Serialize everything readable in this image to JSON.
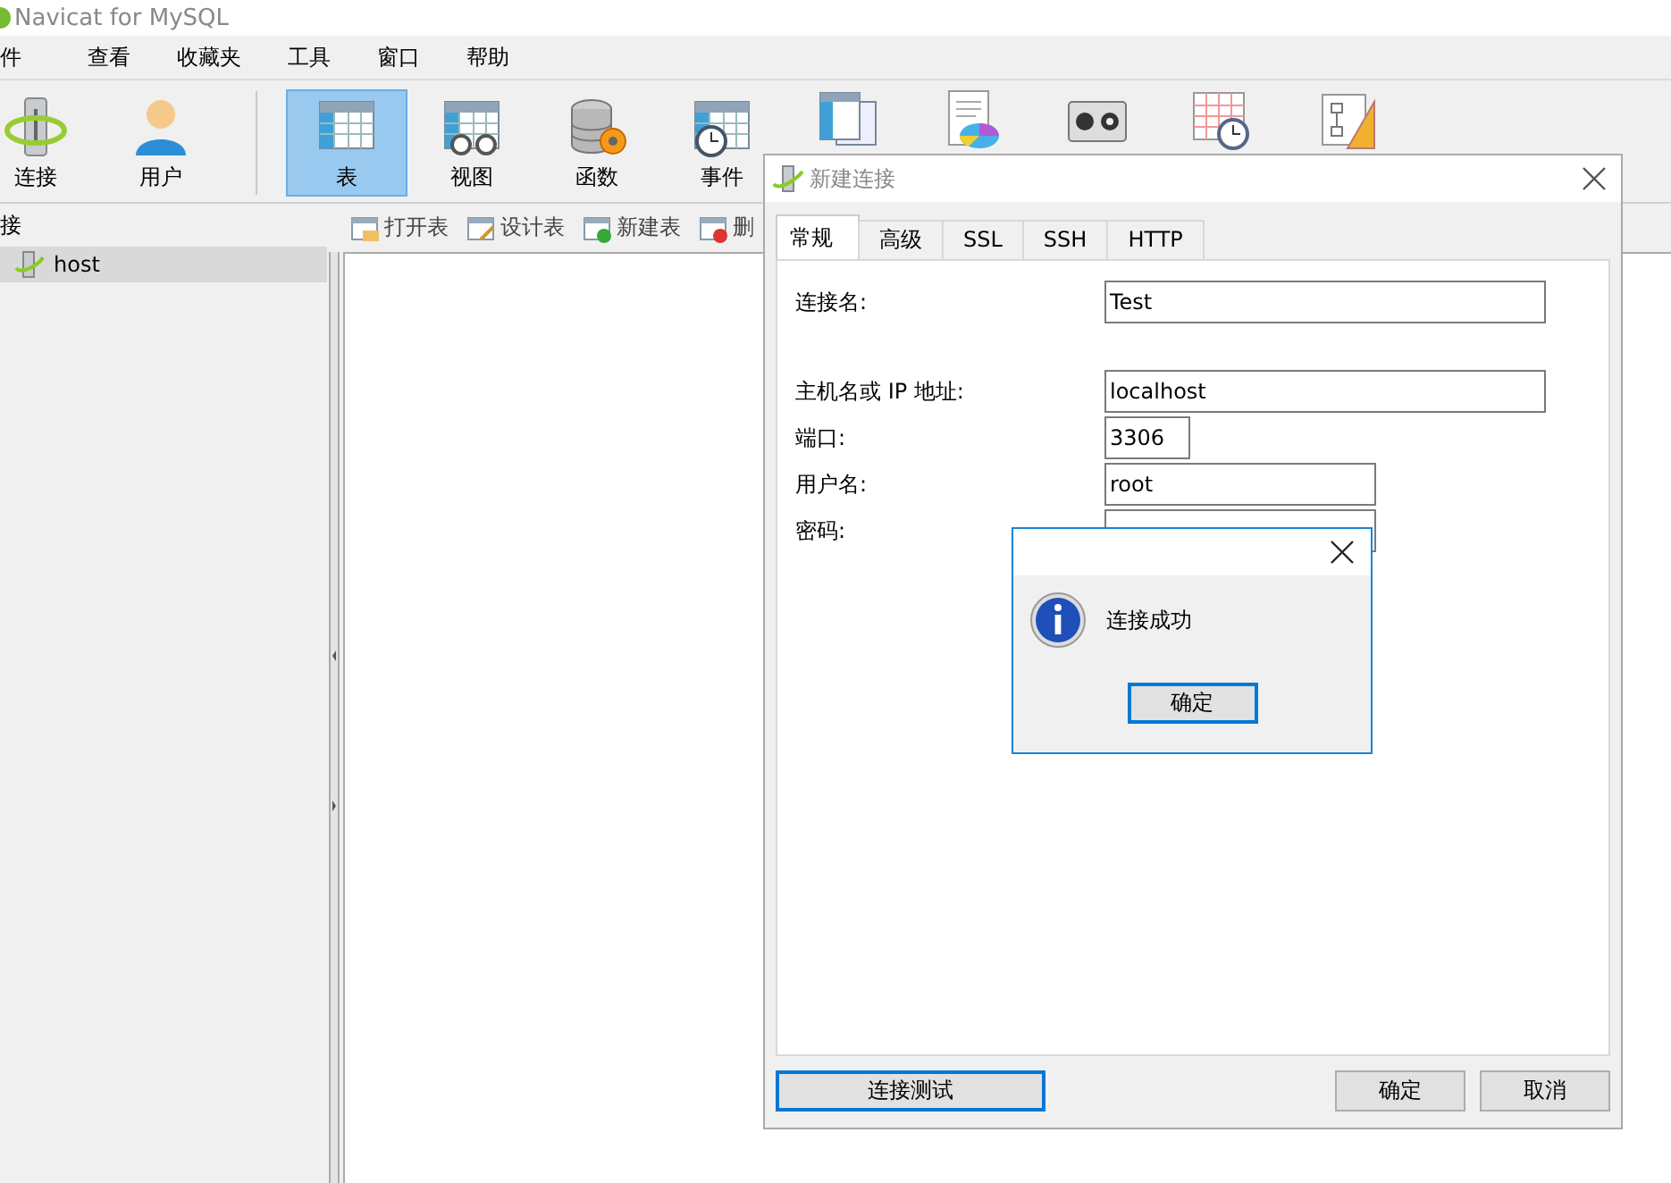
{
  "app": {
    "title": "Navicat for MySQL"
  },
  "menu": [
    {
      "label": "件"
    },
    {
      "label": "查看"
    },
    {
      "label": "收藏夹"
    },
    {
      "label": "工具"
    },
    {
      "label": "窗口"
    },
    {
      "label": "帮助"
    }
  ],
  "toolbar": [
    {
      "label": "连接",
      "selected": false
    },
    {
      "label": "用户",
      "selected": false
    },
    {
      "kind": "separator"
    },
    {
      "label": "表",
      "selected": true
    },
    {
      "label": "视图",
      "selected": false
    },
    {
      "label": "函数",
      "selected": false
    },
    {
      "label": "事件",
      "selected": false
    },
    {
      "selected": false
    },
    {
      "selected": false
    },
    {
      "selected": false
    },
    {
      "selected": false
    },
    {
      "selected": false
    }
  ],
  "sidebar": {
    "header": "接",
    "items": [
      {
        "label": "host",
        "selected": true
      }
    ]
  },
  "object_toolbar": [
    {
      "label": "打开表"
    },
    {
      "label": "设计表"
    },
    {
      "label": "新建表"
    },
    {
      "label": "删"
    }
  ],
  "dialog": {
    "title": "新建连接",
    "tabs": [
      {
        "label": "常规",
        "selected": true
      },
      {
        "label": "高级",
        "selected": false
      },
      {
        "label": "SSL",
        "selected": false
      },
      {
        "label": "SSH",
        "selected": false
      },
      {
        "label": "HTTP",
        "selected": false
      }
    ],
    "field_groups": [
      [
        {
          "label": "连接名:",
          "value": "Test",
          "kind": "wide"
        }
      ],
      [
        {
          "label": "主机名或 IP 地址:",
          "value": "localhost",
          "kind": "wide"
        },
        {
          "label": "端口:",
          "value": "3306",
          "kind": "short"
        },
        {
          "label": "用户名:",
          "value": "root",
          "kind": "medium"
        },
        {
          "label": "密码:",
          "kind": "medium"
        }
      ]
    ],
    "test_button": {
      "label": "连接测试",
      "focused": true
    },
    "buttons": [
      {
        "label": "确定",
        "focused": false
      },
      {
        "label": "取消",
        "focused": false
      }
    ]
  },
  "message_box": {
    "message": "连接成功",
    "button": {
      "label": "确定",
      "focused": true
    }
  }
}
